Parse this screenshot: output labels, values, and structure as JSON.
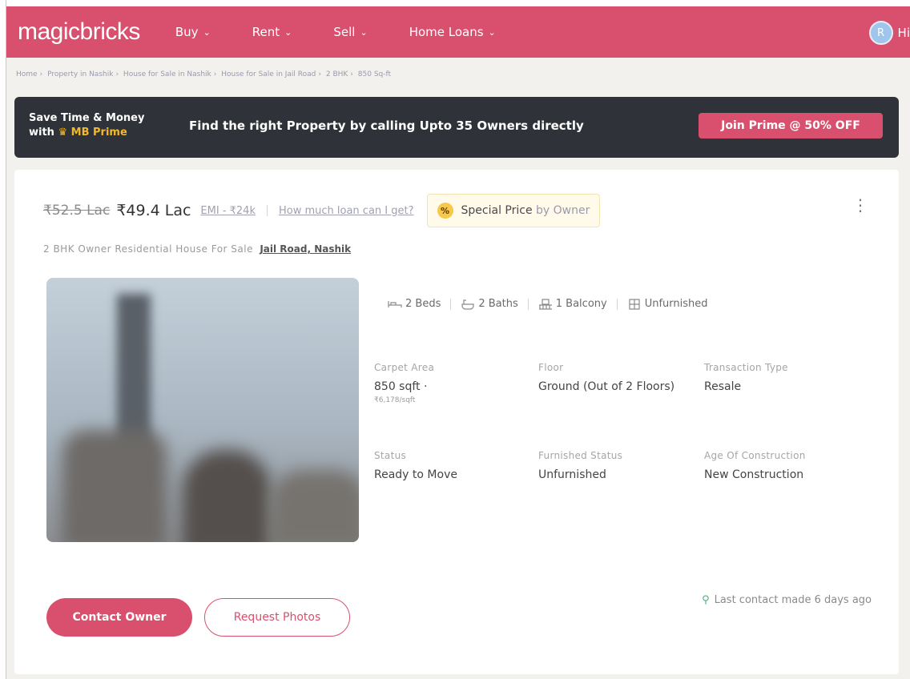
{
  "header": {
    "logo": "magicbricks",
    "nav": [
      {
        "label": "Buy"
      },
      {
        "label": "Rent"
      },
      {
        "label": "Sell"
      },
      {
        "label": "Home Loans"
      }
    ],
    "user": {
      "initial": "R",
      "greeting": "Hi"
    }
  },
  "breadcrumb": [
    "Home",
    "Property in Nashik",
    "House for Sale in Nashik",
    "House for Sale in Jail Road",
    "2 BHK",
    "850 Sq-ft"
  ],
  "prime": {
    "line1": "Save Time & Money",
    "line2_prefix": "with",
    "line2_brand": "MB Prime",
    "message": "Find the right Property by calling Upto 35 Owners directly",
    "cta": "Join Prime @ 50% OFF"
  },
  "listing": {
    "old_price": "₹52.5 Lac",
    "price": "₹49.4 Lac",
    "emi": "EMI - ₹24k",
    "loan_link": "How much loan can I get?",
    "special_badge": "%",
    "special_main": "Special Price",
    "special_by": "by Owner",
    "title": "2 BHK Owner Residential House For Sale",
    "location": "Jail Road, Nashik",
    "features": [
      {
        "icon": "bed-icon",
        "label": "2 Beds"
      },
      {
        "icon": "bath-icon",
        "label": "2 Baths"
      },
      {
        "icon": "balcony-icon",
        "label": "1 Balcony"
      },
      {
        "icon": "furnish-icon",
        "label": "Unfurnished"
      }
    ],
    "specs": {
      "carpet_area": {
        "label": "Carpet Area",
        "value": "850 sqft ·",
        "sub": "₹6,178/sqft"
      },
      "floor": {
        "label": "Floor",
        "value": "Ground (Out of 2 Floors)"
      },
      "transaction": {
        "label": "Transaction Type",
        "value": "Resale"
      },
      "status": {
        "label": "Status",
        "value": "Ready to Move"
      },
      "furnished": {
        "label": "Furnished Status",
        "value": "Unfurnished"
      },
      "age": {
        "label": "Age Of Construction",
        "value": "New Construction"
      }
    },
    "contact_button": "Contact Owner",
    "photos_button": "Request Photos",
    "last_contact": "Last contact made 6 days ago"
  },
  "colors": {
    "brand": "#d8506d",
    "banner_bg": "#2f3238",
    "prime_gold": "#f2b82e",
    "contact_green": "#48b37a"
  }
}
